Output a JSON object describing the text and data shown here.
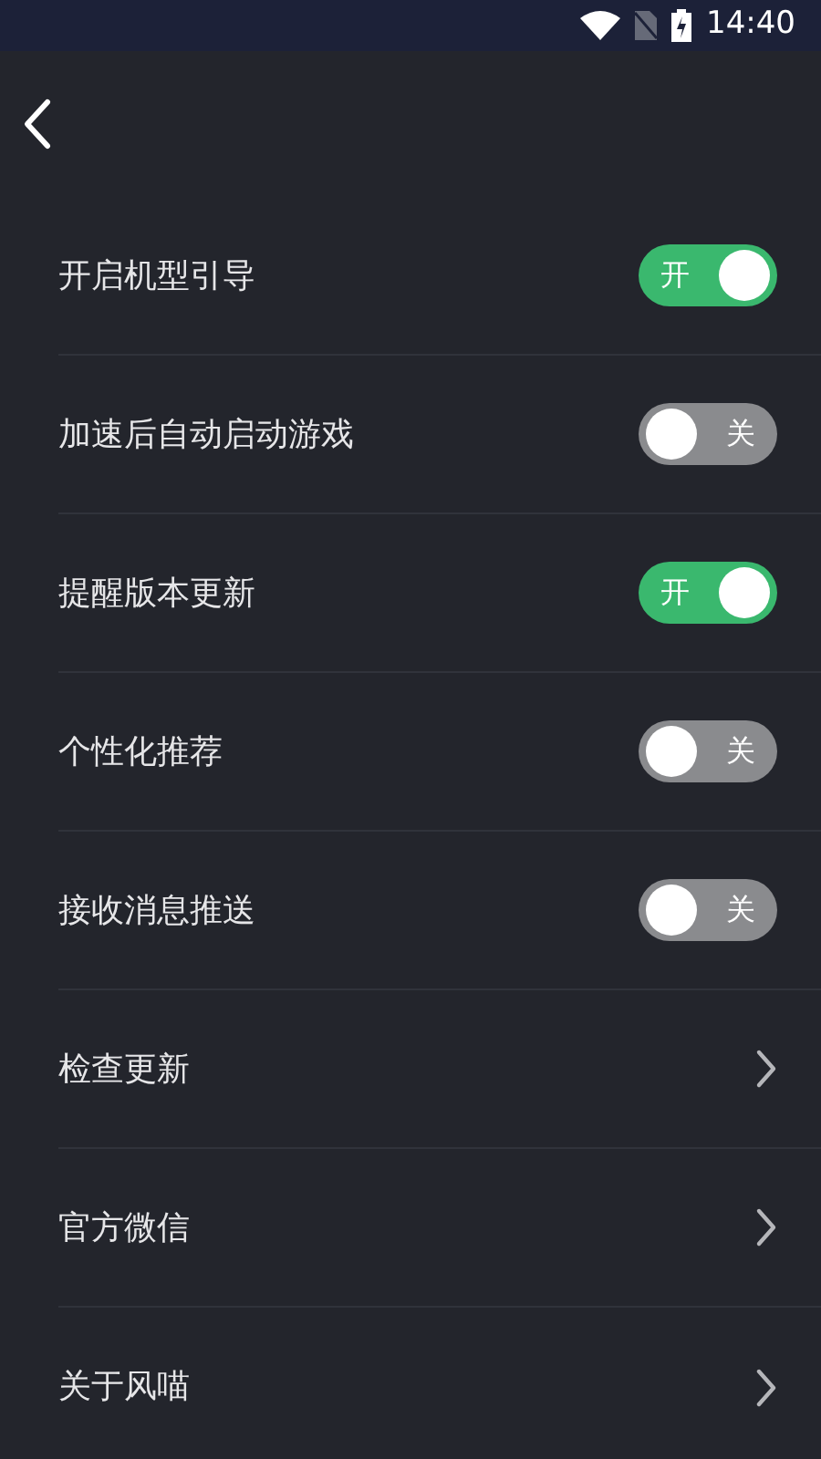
{
  "status_bar": {
    "time": "14:40"
  },
  "settings": [
    {
      "kind": "toggle",
      "label": "开启机型引导",
      "on": true,
      "switch_text": "开"
    },
    {
      "kind": "toggle",
      "label": "加速后自动启动游戏",
      "on": false,
      "switch_text": "关"
    },
    {
      "kind": "toggle",
      "label": "提醒版本更新",
      "on": true,
      "switch_text": "开"
    },
    {
      "kind": "toggle",
      "label": "个性化推荐",
      "on": false,
      "switch_text": "关"
    },
    {
      "kind": "toggle",
      "label": "接收消息推送",
      "on": false,
      "switch_text": "关"
    },
    {
      "kind": "link",
      "label": "检查更新"
    },
    {
      "kind": "link",
      "label": "官方微信"
    },
    {
      "kind": "link",
      "label": "关于风喵"
    }
  ]
}
